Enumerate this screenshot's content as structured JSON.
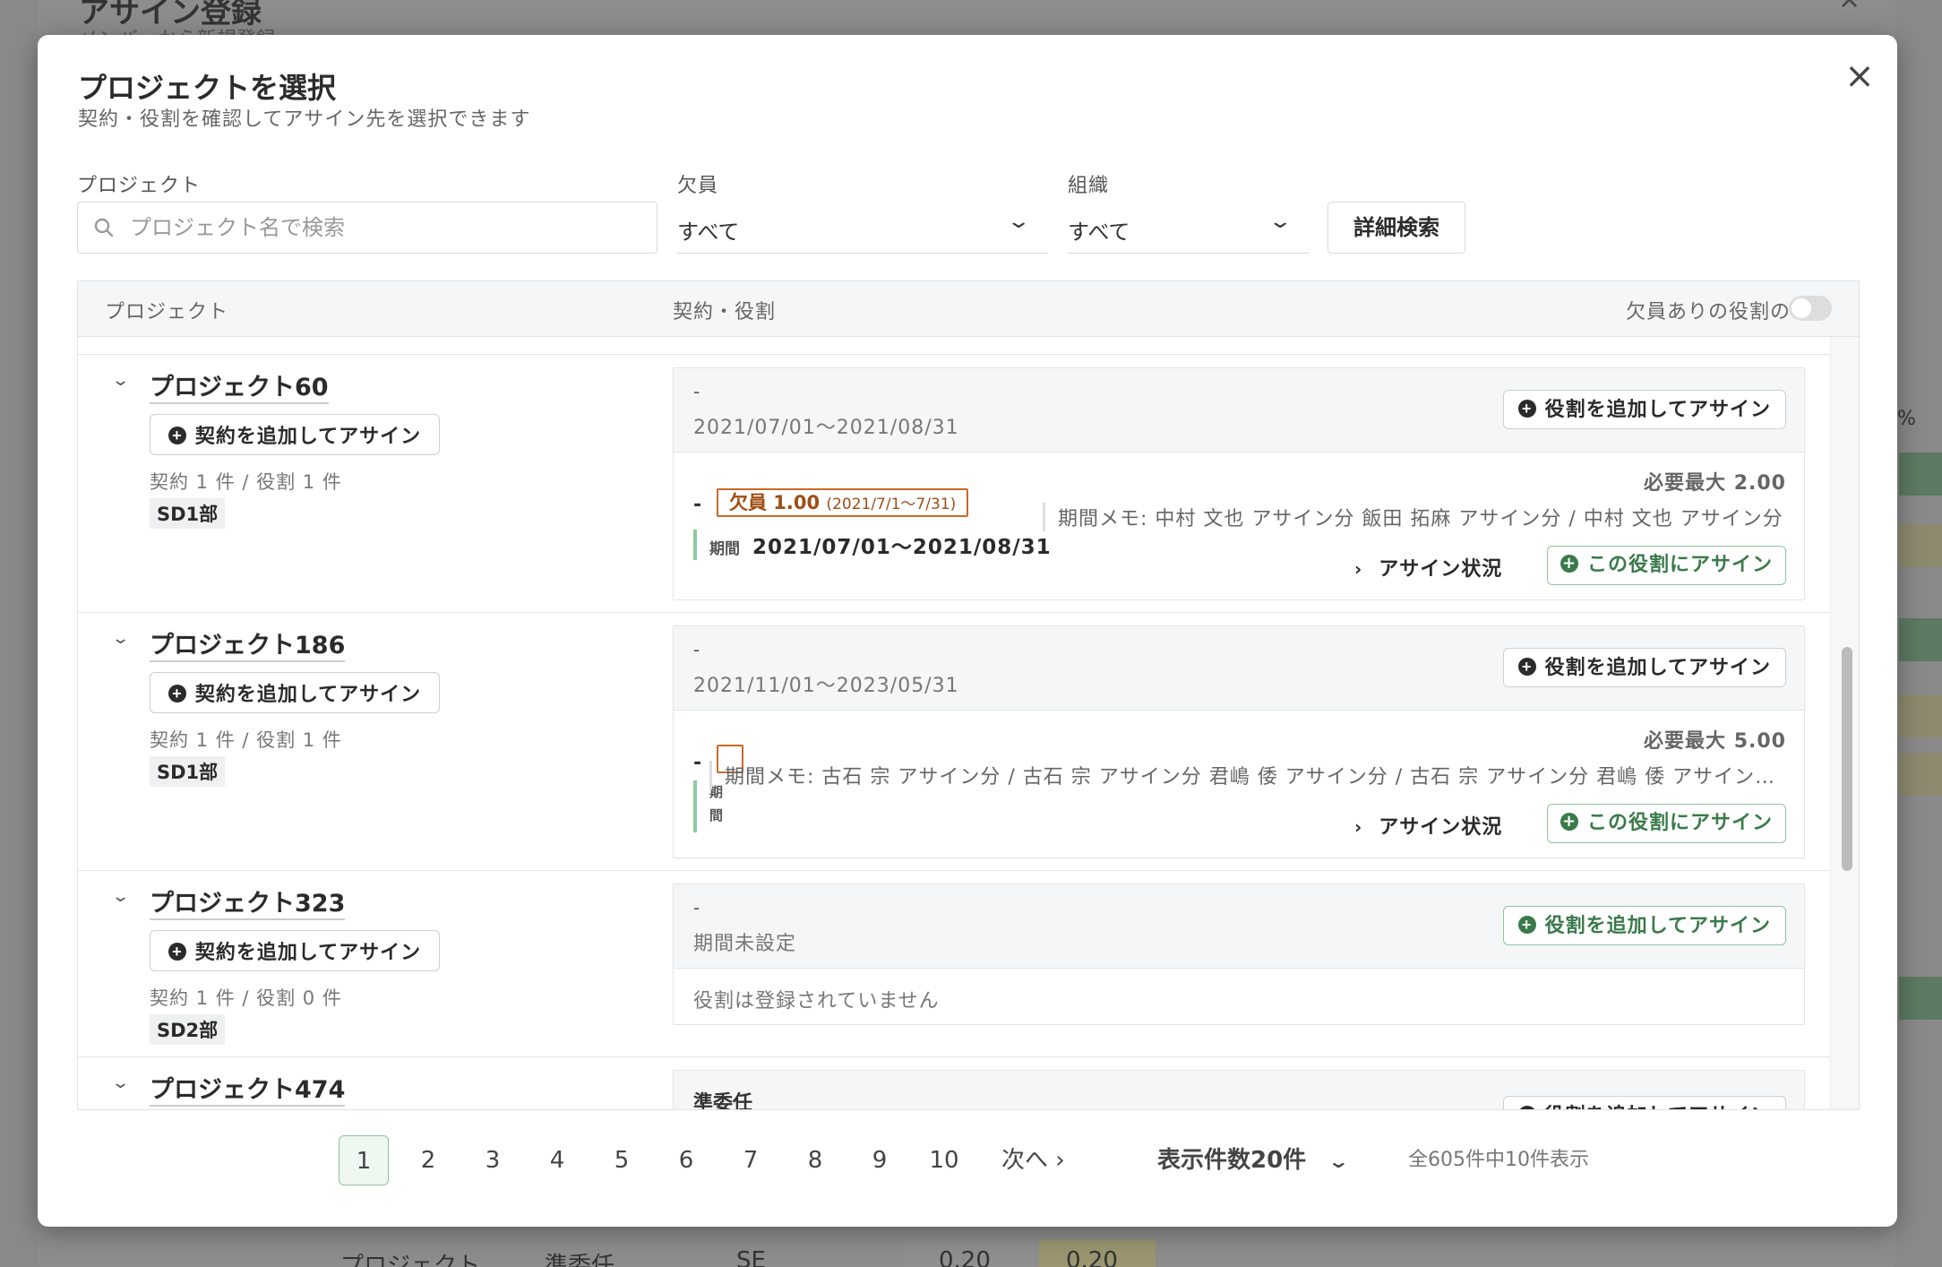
{
  "background": {
    "title": "アサイン登録",
    "subtitle": "メンバーから新規登録",
    "row_label": "プロジェクト…",
    "row_role": "準委任",
    "row_type": "SE",
    "row_val1": "0.20",
    "row_val2": "0.20",
    "side_pct": "%"
  },
  "modal": {
    "title": "プロジェクトを選択",
    "subtitle": "契約・役割を確認してアサイン先を選択できます",
    "close": "×"
  },
  "filters": {
    "project_label": "プロジェクト",
    "project_placeholder": "プロジェクト名で検索",
    "vacancy_label": "欠員",
    "vacancy_value": "すべて",
    "org_label": "組織",
    "org_value": "すべて",
    "advanced_search": "詳細検索"
  },
  "table": {
    "col_project": "プロジェクト",
    "col_contract": "契約・役割",
    "toggle_label": "欠員ありの役割のみ",
    "add_contract_label": "契約を追加してアサイン",
    "add_role_label": "役割を追加してアサイン",
    "assign_status_label": "アサイン状況",
    "assign_role_label": "この役割にアサイン",
    "period_label": "期間",
    "projects": [
      {
        "name": "プロジェクト60",
        "counts": "契約 1 件 / 役割 1 件",
        "org": "SD1部",
        "contract_title": "-",
        "contract_period": "2021/07/01〜2021/08/31",
        "role_dash": "-",
        "shortage": "欠員 1.00",
        "shortage_range": "(2021/7/1〜7/31)",
        "role_period": "2021/07/01〜2021/08/31",
        "need_max": "必要最大 2.00",
        "memo": "期間メモ: 中村 文也 アサイン分 飯田 拓麻 アサイン分 / 中村 文也 アサイン分"
      },
      {
        "name": "プロジェクト186",
        "counts": "契約 1 件 / 役割 1 件",
        "org": "SD1部",
        "contract_title": "-",
        "contract_period": "2021/11/01〜2023/05/31",
        "role_dash": "-",
        "role_period_label_1": "期",
        "role_period_label_2": "間",
        "need_max": "必要最大 5.00",
        "memo": "期間メモ: 古石 宗 アサイン分 / 古石 宗 アサイン分 君嶋 倭 アサイン分 / 古石 宗 アサイン分 君嶋 倭 アサイン…"
      },
      {
        "name": "プロジェクト323",
        "counts": "契約 1 件 / 役割 0 件",
        "org": "SD2部",
        "contract_title": "-",
        "contract_period": "期間未設定",
        "no_role": "役割は登録されていません"
      },
      {
        "name": "プロジェクト474",
        "contract_title": "準委任"
      }
    ]
  },
  "pagination": {
    "pages": [
      "1",
      "2",
      "3",
      "4",
      "5",
      "6",
      "7",
      "8",
      "9",
      "10"
    ],
    "current": "1",
    "next": "次へ ›",
    "per_page": "表示件数20件",
    "total": "全605件中10件表示"
  },
  "colors": {
    "accent_green": "#3a7a4a",
    "shortage_orange": "#c86a2a"
  },
  "icons": [
    "search-icon",
    "close-icon",
    "chevron-down-icon",
    "plus-circle-icon",
    "chevron-right-icon"
  ]
}
